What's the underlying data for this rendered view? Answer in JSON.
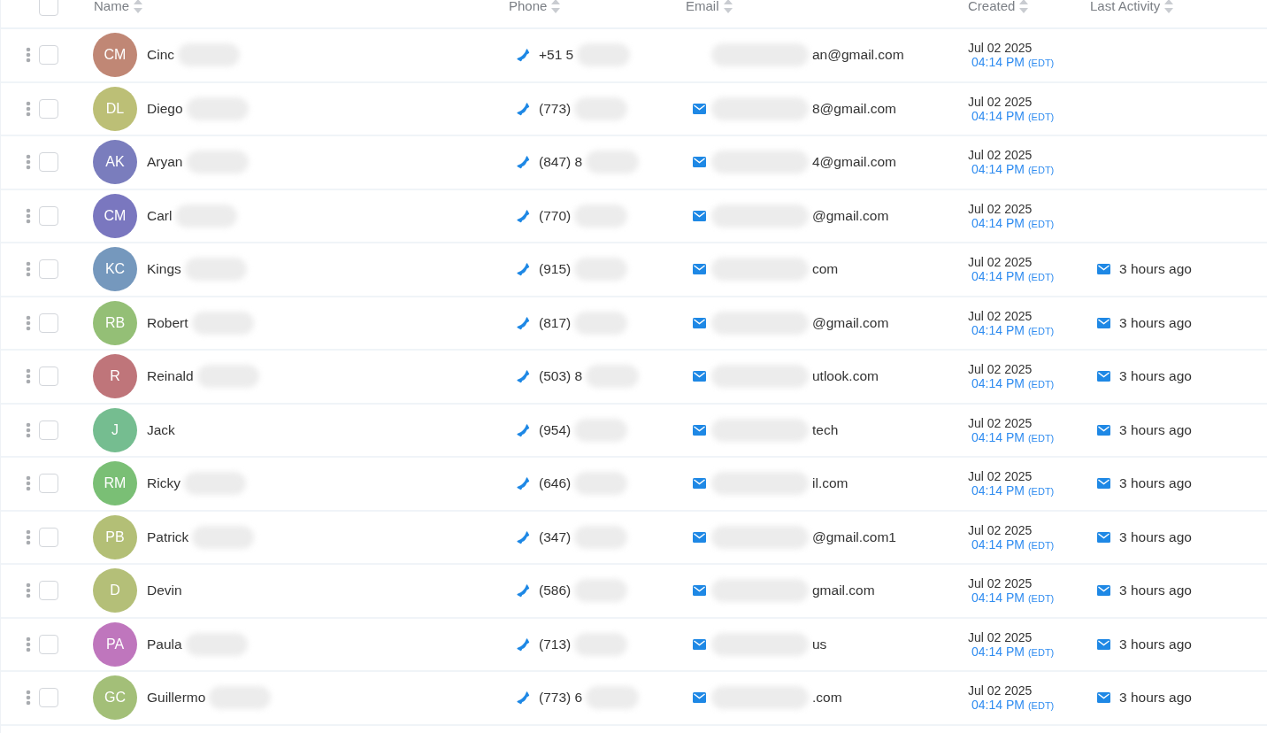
{
  "table": {
    "columns": [
      {
        "label": "Name"
      },
      {
        "label": "Phone"
      },
      {
        "label": "Email"
      },
      {
        "label": "Created"
      },
      {
        "label": "Last Activity"
      }
    ],
    "header_checkbox": {
      "checked": false
    },
    "rows": [
      {
        "checked": false,
        "initials": "CM",
        "color": "#c08775",
        "name": "Cinc",
        "name_redacted": true,
        "phone": "+51 5",
        "email": "an@gmail.com",
        "email_icon": false,
        "created_date": "Jul 02 2025",
        "created_time": "04:14 PM",
        "timezone": "(EDT)"
      },
      {
        "checked": false,
        "initials": "DL",
        "color": "#bcbf76",
        "name": "Diego",
        "name_redacted": true,
        "phone": "(773)",
        "email": "8@gmail.com",
        "email_icon": true,
        "created_date": "Jul 02 2025",
        "created_time": "04:14 PM",
        "timezone": "(EDT)"
      },
      {
        "checked": false,
        "initials": "AK",
        "color": "#7a7dbd",
        "name": "Aryan",
        "name_redacted": true,
        "phone": "(847) 8",
        "email": "4@gmail.com",
        "email_icon": true,
        "created_date": "Jul 02 2025",
        "created_time": "04:14 PM",
        "timezone": "(EDT)"
      },
      {
        "checked": false,
        "initials": "CM",
        "color": "#7a77bf",
        "name": "Carl",
        "name_redacted": true,
        "phone": "(770)",
        "email": "@gmail.com",
        "email_icon": true,
        "created_date": "Jul 02 2025",
        "created_time": "04:14 PM",
        "timezone": "(EDT)"
      },
      {
        "checked": false,
        "initials": "KC",
        "color": "#7598bd",
        "name": "Kings",
        "name_redacted": true,
        "phone": "(915)",
        "email": "com",
        "email_icon": true,
        "created_date": "Jul 02 2025",
        "created_time": "04:14 PM",
        "timezone": "(EDT)",
        "last_activity": "3 hours ago"
      },
      {
        "checked": false,
        "initials": "RB",
        "color": "#94bf76",
        "name": "Robert",
        "name_redacted": true,
        "phone": "(817)",
        "email": "@gmail.com",
        "email_icon": true,
        "created_date": "Jul 02 2025",
        "created_time": "04:14 PM",
        "timezone": "(EDT)",
        "last_activity": "3 hours ago"
      },
      {
        "checked": false,
        "initials": "R",
        "color": "#bf757a",
        "name": "Reinald",
        "name_redacted": true,
        "phone": "(503) 8",
        "email": "utlook.com",
        "email_icon": true,
        "created_date": "Jul 02 2025",
        "created_time": "04:14 PM",
        "timezone": "(EDT)",
        "last_activity": "3 hours ago"
      },
      {
        "checked": false,
        "initials": "J",
        "color": "#75bd90",
        "name": "Jack",
        "name_redacted": false,
        "phone": "(954)",
        "email": "tech",
        "email_icon": true,
        "created_date": "Jul 02 2025",
        "created_time": "04:14 PM",
        "timezone": "(EDT)",
        "last_activity": "3 hours ago"
      },
      {
        "checked": false,
        "initials": "RM",
        "color": "#7abf75",
        "name": "Ricky",
        "name_redacted": true,
        "phone": "(646)",
        "email": "il.com",
        "email_icon": true,
        "created_date": "Jul 02 2025",
        "created_time": "04:14 PM",
        "timezone": "(EDT)",
        "last_activity": "3 hours ago"
      },
      {
        "checked": false,
        "initials": "PB",
        "color": "#b3bf76",
        "name": "Patrick",
        "name_redacted": true,
        "phone": "(347)",
        "email": "@gmail.com1",
        "email_icon": true,
        "created_date": "Jul 02 2025",
        "created_time": "04:14 PM",
        "timezone": "(EDT)",
        "last_activity": "3 hours ago"
      },
      {
        "checked": false,
        "initials": "D",
        "color": "#b4bf78",
        "name": "Devin",
        "name_redacted": false,
        "phone": "(586)",
        "email": "gmail.com",
        "email_icon": true,
        "created_date": "Jul 02 2025",
        "created_time": "04:14 PM",
        "timezone": "(EDT)",
        "last_activity": "3 hours ago"
      },
      {
        "checked": false,
        "initials": "PA",
        "color": "#bf76bd",
        "name": "Paula",
        "name_redacted": true,
        "phone": "(713)",
        "email": "us",
        "email_icon": true,
        "created_date": "Jul 02 2025",
        "created_time": "04:14 PM",
        "timezone": "(EDT)",
        "last_activity": "3 hours ago"
      },
      {
        "checked": false,
        "initials": "GC",
        "color": "#a3bf78",
        "name": "Guillermo",
        "name_redacted": true,
        "phone": "(773) 6",
        "email": ".com",
        "email_icon": true,
        "created_date": "Jul 02 2025",
        "created_time": "04:14 PM",
        "timezone": "(EDT)",
        "last_activity": "3 hours ago"
      }
    ]
  }
}
